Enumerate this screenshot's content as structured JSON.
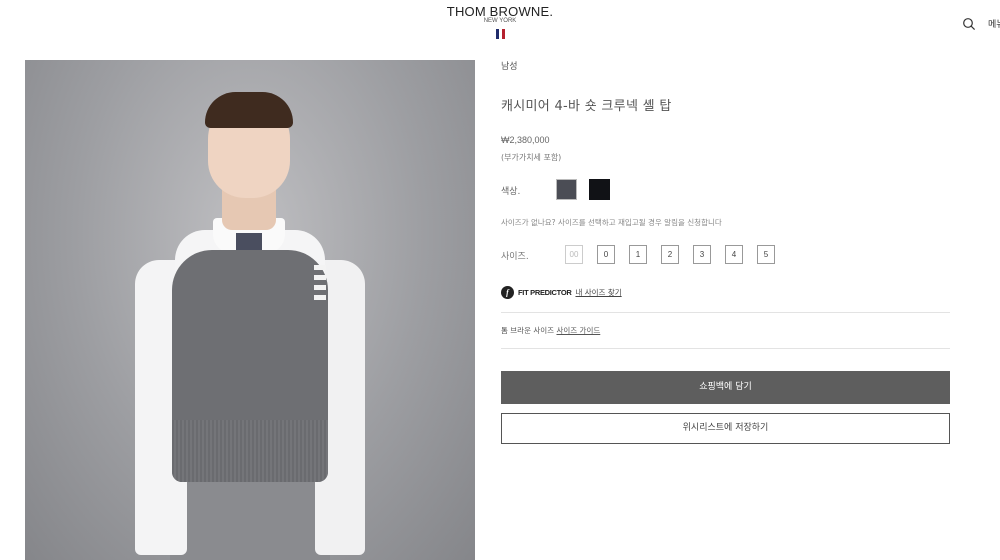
{
  "header": {
    "brand": "THOM BROWNE.",
    "city": "NEW YORK",
    "flag_colors": [
      "#1f2b6b",
      "#ffffff",
      "#b5212e"
    ],
    "search_icon": "search-icon",
    "menu_label": "메뉴"
  },
  "product": {
    "image": "model-wearing-grey-sweater-vest",
    "gender": "남성",
    "title": "캐시미어 4-바 숏 크루넥 셸 탑",
    "price": "₩2,380,000",
    "vat_note": "(부가가치세 포함)",
    "color_label": "색상.",
    "colors": [
      {
        "name": "grey",
        "hex": "#4b4d55",
        "selected": true
      },
      {
        "name": "navy",
        "hex": "#111216",
        "selected": false
      }
    ],
    "size_note": "사이즈가 없나요? 사이즈를 선택하고 재입고될 경우 알림을 신청합니다",
    "size_label": "사이즈.",
    "sizes": [
      {
        "label": "00",
        "available": false
      },
      {
        "label": "0",
        "available": true
      },
      {
        "label": "1",
        "available": true
      },
      {
        "label": "2",
        "available": true
      },
      {
        "label": "3",
        "available": true
      },
      {
        "label": "4",
        "available": true
      },
      {
        "label": "5",
        "available": true
      }
    ],
    "fit_icon_letter": "f",
    "fit_brand": "FIT PREDICTOR",
    "fit_link": "내 사이즈 찾기",
    "guide_prefix": "톰 브라운 사이즈",
    "guide_link": "사이즈 가이드",
    "add_to_bag": "쇼핑백에 담기",
    "wishlist": "위시리스트에 저장하기"
  }
}
